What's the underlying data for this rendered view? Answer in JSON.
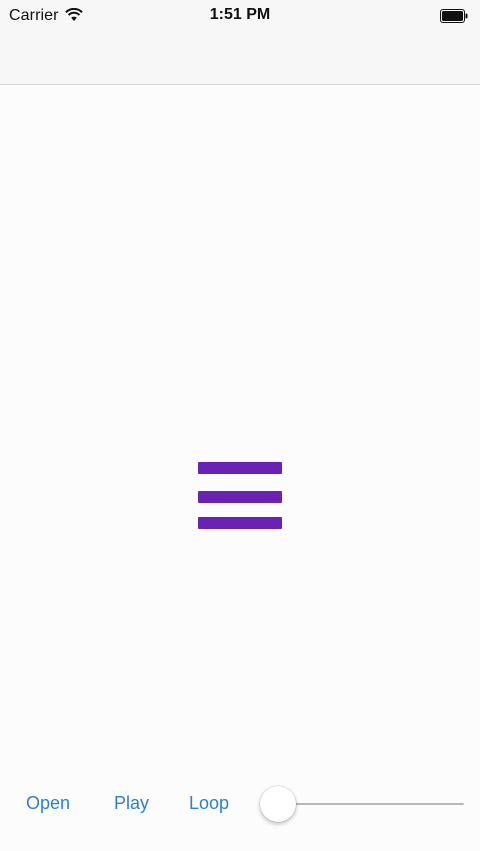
{
  "status_bar": {
    "carrier": "Carrier",
    "time": "1:51 PM"
  },
  "main": {
    "icon": "hamburger-menu-icon",
    "icon_color": "#6a22b4"
  },
  "toolbar": {
    "open_label": "Open",
    "play_label": "Play",
    "loop_label": "Loop",
    "accent_color": "#2f7fd0",
    "slider_value": 0
  }
}
